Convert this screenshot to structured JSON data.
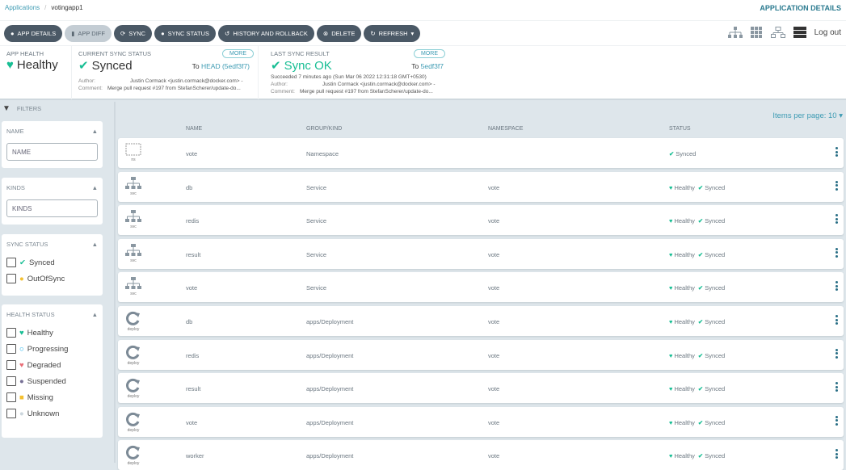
{
  "breadcrumb": {
    "root": "Applications",
    "current": "votingapp1"
  },
  "page_title": "APPLICATION DETAILS",
  "toolbar": {
    "buttons": [
      "APP DETAILS",
      "APP DIFF",
      "SYNC",
      "SYNC STATUS",
      "HISTORY AND ROLLBACK",
      "DELETE",
      "REFRESH"
    ],
    "logout": "Log out"
  },
  "summary": {
    "health": {
      "label": "APP HEALTH",
      "value": "Healthy"
    },
    "current_sync": {
      "label": "CURRENT SYNC STATUS",
      "value": "Synced",
      "more": "MORE",
      "to_prefix": "To",
      "to": "HEAD (5edf3f7)",
      "author_label": "Author:",
      "author": "Justin Cormack <justin.cormack@docker.com> -",
      "comment_label": "Comment:",
      "comment": "Merge pull request #197 from StefanScherer/update-do..."
    },
    "last_sync": {
      "label": "LAST SYNC RESULT",
      "value": "Sync OK",
      "more": "MORE",
      "to_prefix": "To",
      "to": "5edf3f7",
      "succeeded": "Succeeded 7 minutes ago (Sun Mar 06 2022 12:31:18 GMT+0530)",
      "author_label": "Author:",
      "author": "Justin Cormack <justin.cormack@docker.com> -",
      "comment_label": "Comment:",
      "comment": "Merge pull request #197 from StefanScherer/update-do..."
    }
  },
  "filters": {
    "title": "FILTERS",
    "name": {
      "title": "NAME",
      "placeholder": "NAME"
    },
    "kinds": {
      "title": "KINDS",
      "placeholder": "KINDS"
    },
    "sync_status": {
      "title": "SYNC STATUS",
      "options": [
        "Synced",
        "OutOfSync"
      ]
    },
    "health_status": {
      "title": "HEALTH STATUS",
      "options": [
        "Healthy",
        "Progressing",
        "Degraded",
        "Suspended",
        "Missing",
        "Unknown"
      ]
    }
  },
  "items_per_page": "Items per page: 10",
  "table": {
    "headers": [
      "NAME",
      "GROUP/KIND",
      "NAMESPACE",
      "STATUS"
    ],
    "rows": [
      {
        "kind_icon": "ns",
        "name": "vote",
        "group": "Namespace",
        "namespace": "",
        "health": "",
        "sync": "Synced"
      },
      {
        "kind_icon": "svc",
        "name": "db",
        "group": "Service",
        "namespace": "vote",
        "health": "Healthy",
        "sync": "Synced"
      },
      {
        "kind_icon": "svc",
        "name": "redis",
        "group": "Service",
        "namespace": "vote",
        "health": "Healthy",
        "sync": "Synced"
      },
      {
        "kind_icon": "svc",
        "name": "result",
        "group": "Service",
        "namespace": "vote",
        "health": "Healthy",
        "sync": "Synced"
      },
      {
        "kind_icon": "svc",
        "name": "vote",
        "group": "Service",
        "namespace": "vote",
        "health": "Healthy",
        "sync": "Synced"
      },
      {
        "kind_icon": "deploy",
        "name": "db",
        "group": "apps/Deployment",
        "namespace": "vote",
        "health": "Healthy",
        "sync": "Synced"
      },
      {
        "kind_icon": "deploy",
        "name": "redis",
        "group": "apps/Deployment",
        "namespace": "vote",
        "health": "Healthy",
        "sync": "Synced"
      },
      {
        "kind_icon": "deploy",
        "name": "result",
        "group": "apps/Deployment",
        "namespace": "vote",
        "health": "Healthy",
        "sync": "Synced"
      },
      {
        "kind_icon": "deploy",
        "name": "vote",
        "group": "apps/Deployment",
        "namespace": "vote",
        "health": "Healthy",
        "sync": "Synced"
      },
      {
        "kind_icon": "deploy",
        "name": "worker",
        "group": "apps/Deployment",
        "namespace": "vote",
        "health": "Healthy",
        "sync": "Synced"
      }
    ]
  },
  "colors": {
    "accent": "#3d9bb3",
    "healthy": "#18be94",
    "button": "#4b5966"
  }
}
